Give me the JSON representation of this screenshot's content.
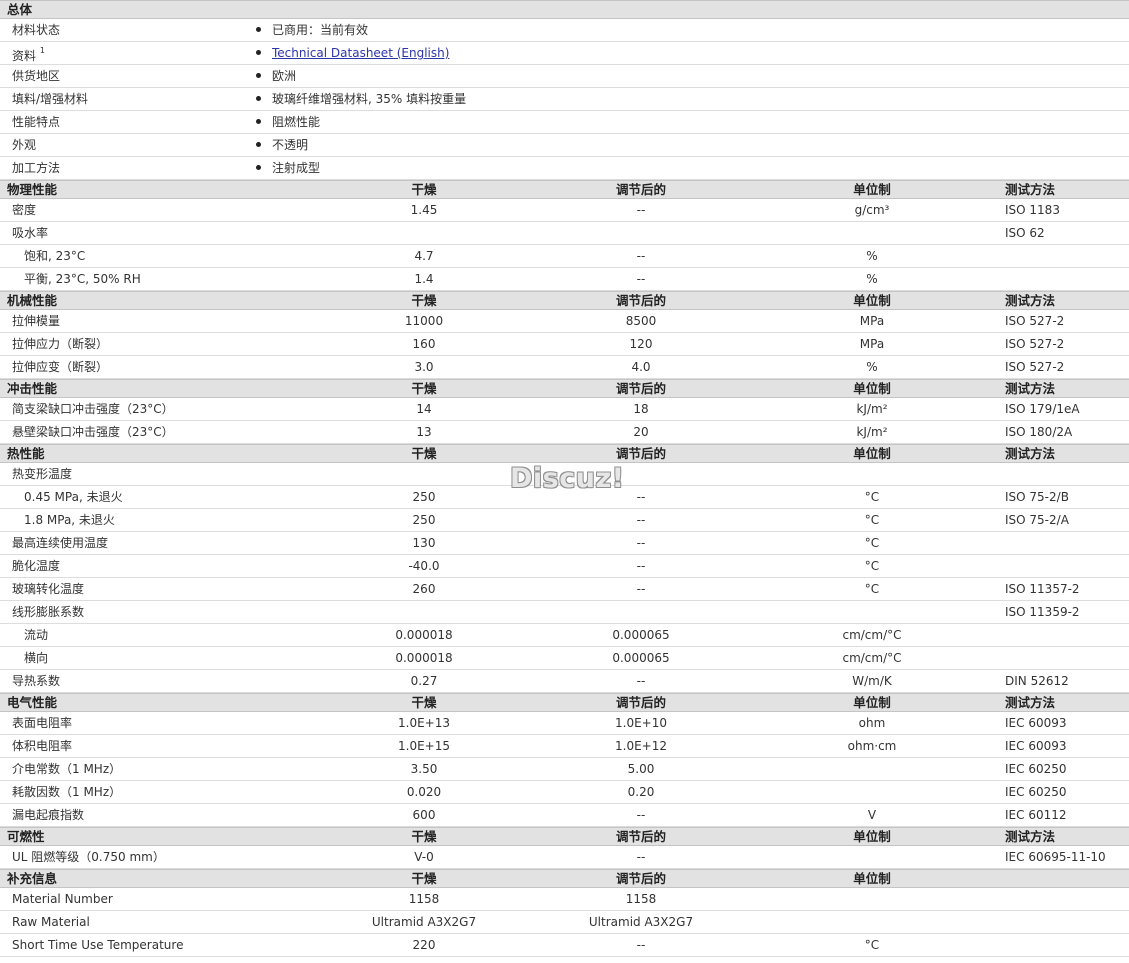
{
  "sections": [
    {
      "title": "总体",
      "kind": "general",
      "rows": [
        {
          "name": "材料状态",
          "value": "已商用：当前有效"
        },
        {
          "name": "资料",
          "note": "1",
          "link": "Technical Datasheet (English)"
        },
        {
          "name": "供货地区",
          "value": "欧洲"
        },
        {
          "name": "填料/增强材料",
          "value": "玻璃纤维增强材料, 35% 填料按重量"
        },
        {
          "name": "性能特点",
          "value": "阻燃性能"
        },
        {
          "name": "外观",
          "value": "不透明"
        },
        {
          "name": "加工方法",
          "value": "注射成型"
        }
      ]
    },
    {
      "title": "物理性能",
      "headers": {
        "dry": "干燥",
        "cond": "调节后的",
        "unit": "单位制",
        "test": "测试方法"
      },
      "rows": [
        {
          "name": "密度",
          "dry": "1.45",
          "cond": "--",
          "unit": "g/cm³",
          "test": "ISO 1183"
        },
        {
          "name": "吸水率",
          "test": "ISO 62"
        },
        {
          "name": "饱和, 23°C",
          "indent": true,
          "dry": "4.7",
          "cond": "--",
          "unit": "%"
        },
        {
          "name": "平衡, 23°C, 50% RH",
          "indent": true,
          "dry": "1.4",
          "cond": "--",
          "unit": "%"
        }
      ]
    },
    {
      "title": "机械性能",
      "headers": {
        "dry": "干燥",
        "cond": "调节后的",
        "unit": "单位制",
        "test": "测试方法"
      },
      "rows": [
        {
          "name": "拉伸模量",
          "dry": "11000",
          "cond": "8500",
          "unit": "MPa",
          "test": "ISO 527-2"
        },
        {
          "name": "拉伸应力（断裂）",
          "dry": "160",
          "cond": "120",
          "unit": "MPa",
          "test": "ISO 527-2"
        },
        {
          "name": "拉伸应变（断裂）",
          "dry": "3.0",
          "cond": "4.0",
          "unit": "%",
          "test": "ISO 527-2"
        }
      ]
    },
    {
      "title": "冲击性能",
      "headers": {
        "dry": "干燥",
        "cond": "调节后的",
        "unit": "单位制",
        "test": "测试方法"
      },
      "rows": [
        {
          "name": "简支梁缺口冲击强度（23°C）",
          "dry": "14",
          "cond": "18",
          "unit": "kJ/m²",
          "test": "ISO 179/1eA"
        },
        {
          "name": "悬壁梁缺口冲击强度（23°C）",
          "dry": "13",
          "cond": "20",
          "unit": "kJ/m²",
          "test": "ISO 180/2A"
        }
      ]
    },
    {
      "title": "热性能",
      "headers": {
        "dry": "干燥",
        "cond": "调节后的",
        "unit": "单位制",
        "test": "测试方法"
      },
      "rows": [
        {
          "name": "热变形温度"
        },
        {
          "name": "0.45 MPa, 未退火",
          "indent": true,
          "dry": "250",
          "cond": "--",
          "unit": "°C",
          "test": "ISO 75-2/B"
        },
        {
          "name": "1.8 MPa, 未退火",
          "indent": true,
          "dry": "250",
          "cond": "--",
          "unit": "°C",
          "test": "ISO 75-2/A"
        },
        {
          "name": "最高连续使用温度",
          "dry": "130",
          "cond": "--",
          "unit": "°C"
        },
        {
          "name": "脆化温度",
          "dry": "-40.0",
          "cond": "--",
          "unit": "°C"
        },
        {
          "name": "玻璃转化温度",
          "dry": "260",
          "cond": "--",
          "unit": "°C",
          "test": "ISO 11357-2"
        },
        {
          "name": "线形膨胀系数",
          "test": "ISO 11359-2"
        },
        {
          "name": "流动",
          "indent": true,
          "dry": "0.000018",
          "cond": "0.000065",
          "unit": "cm/cm/°C"
        },
        {
          "name": "横向",
          "indent": true,
          "dry": "0.000018",
          "cond": "0.000065",
          "unit": "cm/cm/°C"
        },
        {
          "name": "导热系数",
          "dry": "0.27",
          "cond": "--",
          "unit": "W/m/K",
          "test": "DIN 52612"
        }
      ]
    },
    {
      "title": "电气性能",
      "headers": {
        "dry": "干燥",
        "cond": "调节后的",
        "unit": "单位制",
        "test": "测试方法"
      },
      "rows": [
        {
          "name": "表面电阻率",
          "dry": "1.0E+13",
          "cond": "1.0E+10",
          "unit": "ohm",
          "test": "IEC 60093"
        },
        {
          "name": "体积电阻率",
          "dry": "1.0E+15",
          "cond": "1.0E+12",
          "unit": "ohm·cm",
          "test": "IEC 60093"
        },
        {
          "name": "介电常数（1 MHz）",
          "dry": "3.50",
          "cond": "5.00",
          "test": "IEC 60250"
        },
        {
          "name": "耗散因数（1 MHz）",
          "dry": "0.020",
          "cond": "0.20",
          "test": "IEC 60250"
        },
        {
          "name": "漏电起痕指数",
          "dry": "600",
          "cond": "--",
          "unit": "V",
          "test": "IEC 60112"
        }
      ]
    },
    {
      "title": "可燃性",
      "headers": {
        "dry": "干燥",
        "cond": "调节后的",
        "unit": "单位制",
        "test": "测试方法"
      },
      "rows": [
        {
          "name": "UL 阻燃等级（0.750 mm）",
          "dry": "V-0",
          "cond": "--",
          "test": "IEC 60695-11-10"
        }
      ]
    },
    {
      "title": "补充信息",
      "headers": {
        "dry": "干燥",
        "cond": "调节后的",
        "unit": "单位制"
      },
      "rows": [
        {
          "name": "Material Number",
          "dry": "1158",
          "cond": "1158"
        },
        {
          "name": "Raw Material",
          "dry": "Ultramid A3X2G7",
          "cond": "Ultramid A3X2G7"
        },
        {
          "name": "Short Time Use Temperature",
          "dry": "220",
          "cond": "--",
          "unit": "°C"
        }
      ]
    }
  ],
  "watermark": "Discuz!"
}
